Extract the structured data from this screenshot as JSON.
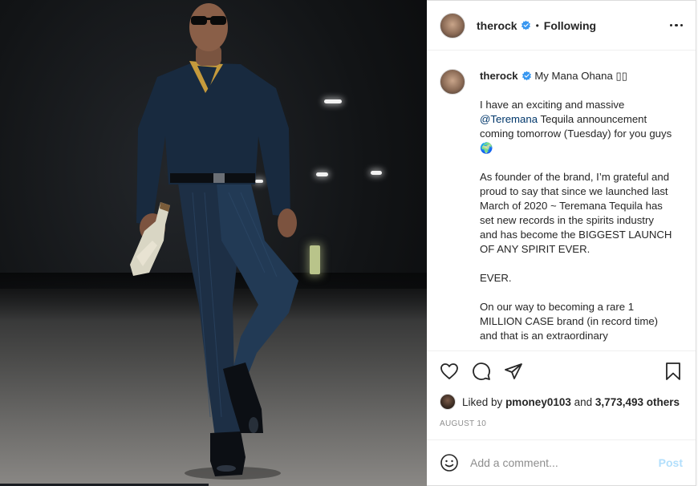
{
  "post": {
    "author": {
      "username": "therock",
      "verified": true,
      "follow_status": "Following",
      "separator": "•"
    },
    "caption": {
      "username": "therock",
      "title_text": "My Mana Ohana",
      "title_emoji": "▯▯",
      "lines": [
        {
          "type": "text",
          "text": "I have an exciting and massive"
        },
        {
          "type": "mention",
          "mention": "@Teremana",
          "text": " Tequila announcement"
        },
        {
          "type": "text",
          "text": "coming tomorrow (Tuesday) for you guys"
        },
        {
          "type": "text",
          "text": "🌍"
        },
        {
          "type": "gap",
          "text": ""
        },
        {
          "type": "text",
          "text": "As founder of the brand, I’m grateful and"
        },
        {
          "type": "text",
          "text": "proud to say that since we launched last"
        },
        {
          "type": "text",
          "text": "March of 2020 ~ Teremana Tequila has"
        },
        {
          "type": "text",
          "text": "set new records in the spirits industry"
        },
        {
          "type": "text",
          "text": "and has become the BIGGEST LAUNCH"
        },
        {
          "type": "text",
          "text": "OF ANY SPIRIT EVER."
        },
        {
          "type": "gap",
          "text": ""
        },
        {
          "type": "text",
          "text": "EVER."
        },
        {
          "type": "gap",
          "text": ""
        },
        {
          "type": "text",
          "text": "On our way to becoming a rare 1"
        },
        {
          "type": "text",
          "text": "MILLION CASE brand (in record time)"
        },
        {
          "type": "text",
          "text": "and that is an extraordinary"
        }
      ]
    },
    "likes": {
      "prefix": "Liked by",
      "first_user": "pmoney0103",
      "joiner": "and",
      "others": "3,773,493 others"
    },
    "date": "AUGUST 10",
    "comment": {
      "placeholder": "Add a comment...",
      "post_label": "Post"
    },
    "icons": {
      "like": "heart-icon",
      "comment": "comment-icon",
      "share": "share-icon",
      "save": "bookmark-icon",
      "emoji": "emoji-icon",
      "more": "more-options-icon",
      "verified": "verified-badge-icon"
    },
    "colors": {
      "verified_blue": "#3897f0",
      "mention": "#00376b",
      "post_disabled": "#b2dffc",
      "muted": "#8e8e8e"
    }
  }
}
